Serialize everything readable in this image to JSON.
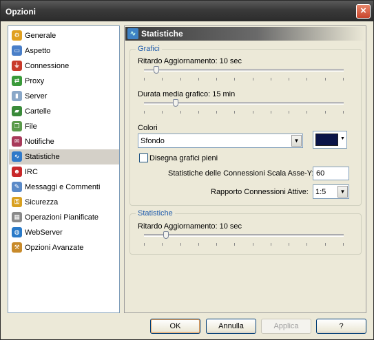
{
  "window": {
    "title": "Opzioni",
    "close_glyph": "×"
  },
  "sidebar": {
    "selected_index": 8,
    "items": [
      {
        "label": "Generale",
        "icon": "gear-icon",
        "color": "#e0a020",
        "glyph": "⚙"
      },
      {
        "label": "Aspetto",
        "icon": "monitor-icon",
        "color": "#4a7fc8",
        "glyph": "▭"
      },
      {
        "label": "Connessione",
        "icon": "plug-icon",
        "color": "#c83a2a",
        "glyph": "⏚"
      },
      {
        "label": "Proxy",
        "icon": "proxy-icon",
        "color": "#3a9a3a",
        "glyph": "⇄"
      },
      {
        "label": "Server",
        "icon": "server-icon",
        "color": "#8aa8c8",
        "glyph": "▮"
      },
      {
        "label": "Cartelle",
        "icon": "folder-icon",
        "color": "#3a8a3a",
        "glyph": "▰"
      },
      {
        "label": "File",
        "icon": "files-icon",
        "color": "#5a9a4a",
        "glyph": "❐"
      },
      {
        "label": "Notifiche",
        "icon": "notification-icon",
        "color": "#a83a5a",
        "glyph": "✉"
      },
      {
        "label": "Statistiche",
        "icon": "statistics-icon",
        "color": "#2f79c9",
        "glyph": "∿"
      },
      {
        "label": "IRC",
        "icon": "irc-icon",
        "color": "#c8282a",
        "glyph": "☻"
      },
      {
        "label": "Messaggi e Commenti",
        "icon": "messages-icon",
        "color": "#5a8ac8",
        "glyph": "✎"
      },
      {
        "label": "Sicurezza",
        "icon": "lock-icon",
        "color": "#d8a020",
        "glyph": "⚿"
      },
      {
        "label": "Operazioni Pianificate",
        "icon": "calendar-icon",
        "color": "#8a8a8a",
        "glyph": "▦"
      },
      {
        "label": "WebServer",
        "icon": "globe-icon",
        "color": "#2a7ac8",
        "glyph": "◍"
      },
      {
        "label": "Opzioni Avanzate",
        "icon": "advanced-icon",
        "color": "#c88a2a",
        "glyph": "⚒"
      }
    ]
  },
  "panel": {
    "header_title": "Statistiche",
    "header_icon": "statistics-icon",
    "grafici": {
      "legend": "Grafici",
      "refresh_label": "Ritardo Aggiornamento: 10 sec",
      "refresh_level": 0.05,
      "duration_label": "Durata media grafico: 15 min",
      "duration_level": 0.15,
      "colors_label": "Colori",
      "colors_selected": "Sfondo",
      "color_value": "#0a1448",
      "fill_label": "Disegna grafici pieni",
      "fill_checked": false,
      "scale_label": "Statistiche delle Connessioni Scala Asse-Y:",
      "scale_value": "60",
      "ratio_label": "Rapporto Connessioni Attive:",
      "ratio_selected": "1:5"
    },
    "statistiche": {
      "legend": "Statistiche",
      "refresh_label": "Ritardo Aggiornamento: 10 sec",
      "refresh_level": 0.1
    }
  },
  "buttons": {
    "ok": "OK",
    "cancel": "Annulla",
    "apply": "Applica",
    "help": "?"
  },
  "dropdown_arrow": "▼"
}
